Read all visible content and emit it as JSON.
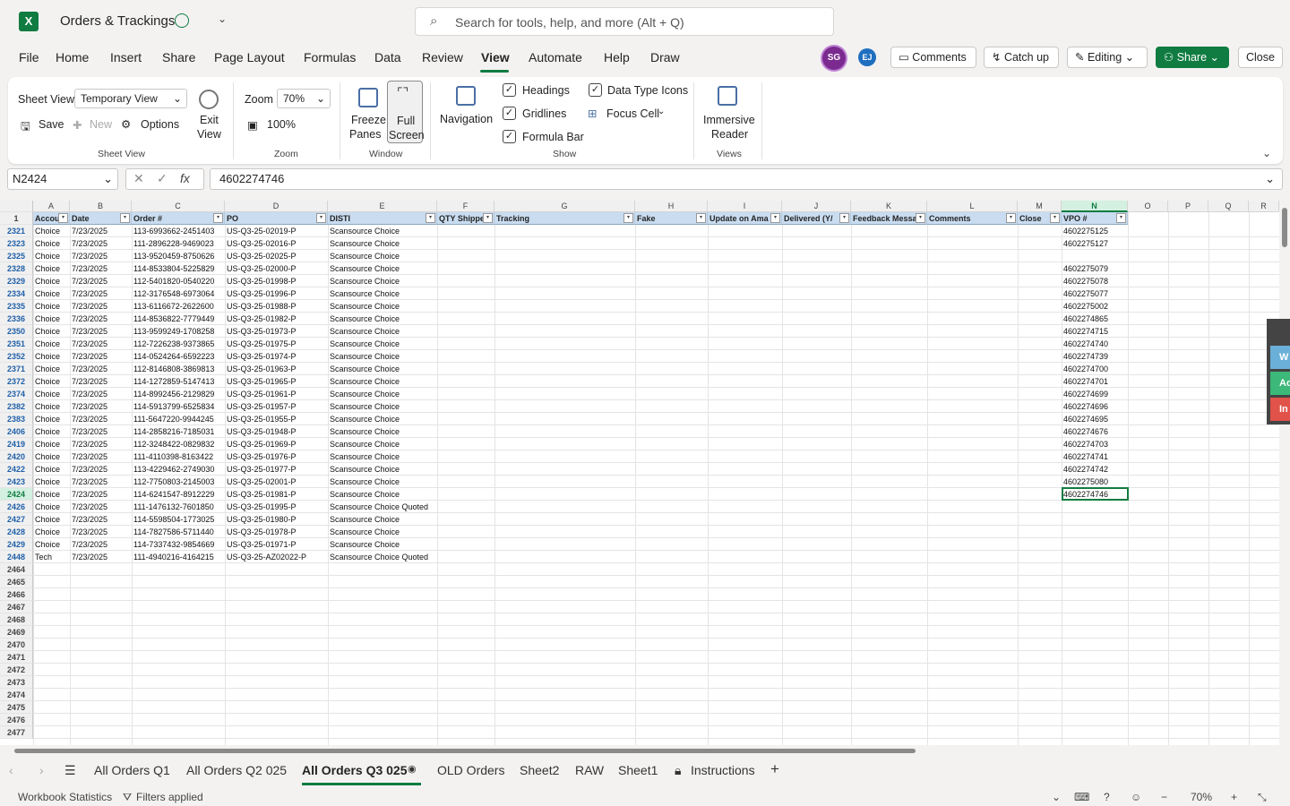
{
  "titlebar": {
    "app_icon": "excel-icon",
    "doc_title": "Orders & Trackings",
    "search_placeholder": "Search for tools, help, and more (Alt + Q)"
  },
  "menu": [
    "File",
    "Home",
    "Insert",
    "Share",
    "Page Layout",
    "Formulas",
    "Data",
    "Review",
    "View",
    "Automate",
    "Help",
    "Draw"
  ],
  "active_menu": "View",
  "header_right": {
    "avatar1": "SG",
    "avatar2": "EJ",
    "comments": "Comments",
    "catchup": "Catch up",
    "editing": "Editing",
    "share": "Share",
    "close": "Close"
  },
  "ribbon": {
    "sheet_view_label": "Sheet View",
    "sheet_view_value": "Temporary View",
    "save": "Save",
    "new": "New",
    "options": "Options",
    "exit_view": "Exit View",
    "exit": "Exit",
    "view": "View",
    "group_sheet_view": "Sheet View",
    "zoom_label": "Zoom",
    "zoom_value": "70%",
    "zoom_100": "100%",
    "group_zoom": "Zoom",
    "freeze": "Freeze",
    "panes": "Panes",
    "full": "Full",
    "screen": "Screen",
    "group_window": "Window",
    "navigation": "Navigation",
    "headings": "Headings",
    "gridlines": "Gridlines",
    "formula_bar": "Formula Bar",
    "data_type_icons": "Data Type Icons",
    "focus_cell": "Focus Cell",
    "group_show": "Show",
    "immersive": "Immersive",
    "reader": "Reader",
    "group_views": "Views"
  },
  "formula_bar": {
    "name_box": "N2424",
    "value": "4602274746"
  },
  "columns": [
    "A",
    "B",
    "C",
    "D",
    "E",
    "F",
    "G",
    "H",
    "I",
    "J",
    "K",
    "L",
    "M",
    "N",
    "O",
    "P",
    "Q",
    "R"
  ],
  "table_headers": [
    "Accou",
    "Date",
    "Order #",
    "PO",
    "DISTI",
    "QTY Shippe",
    "Tracking",
    "Fake",
    "Update on Ama",
    "Delivered (Y/",
    "Feedback Messa",
    "Comments",
    "Close",
    "VPO #"
  ],
  "rows": [
    {
      "row": "2321",
      "acct": "Choice",
      "date": "7/23/2025",
      "order": "113-6993662-2451403",
      "po": "US-Q3-25-02019-P",
      "disti": "Scansource Choice",
      "vpo": "4602275125"
    },
    {
      "row": "2323",
      "acct": "Choice",
      "date": "7/23/2025",
      "order": "111-2896228-9469023",
      "po": "US-Q3-25-02016-P",
      "disti": "Scansource Choice",
      "vpo": "4602275127"
    },
    {
      "row": "2325",
      "acct": "Choice",
      "date": "7/23/2025",
      "order": "113-9520459-8750626",
      "po": "US-Q3-25-02025-P",
      "disti": "Scansource Choice",
      "vpo": ""
    },
    {
      "row": "2328",
      "acct": "Choice",
      "date": "7/23/2025",
      "order": "114-8533804-5225829",
      "po": "US-Q3-25-02000-P",
      "disti": "Scansource Choice",
      "vpo": "4602275079"
    },
    {
      "row": "2329",
      "acct": "Choice",
      "date": "7/23/2025",
      "order": "112-5401820-0540220",
      "po": "US-Q3-25-01998-P",
      "disti": "Scansource Choice",
      "vpo": "4602275078"
    },
    {
      "row": "2334",
      "acct": "Choice",
      "date": "7/23/2025",
      "order": "112-3176548-6973064",
      "po": "US-Q3-25-01996-P",
      "disti": "Scansource Choice",
      "vpo": "4602275077"
    },
    {
      "row": "2335",
      "acct": "Choice",
      "date": "7/23/2025",
      "order": "113-6116672-2622600",
      "po": "US-Q3-25-01988-P",
      "disti": "Scansource Choice",
      "vpo": "4602275002"
    },
    {
      "row": "2336",
      "acct": "Choice",
      "date": "7/23/2025",
      "order": "114-8536822-7779449",
      "po": "US-Q3-25-01982-P",
      "disti": "Scansource Choice",
      "vpo": "4602274865"
    },
    {
      "row": "2350",
      "acct": "Choice",
      "date": "7/23/2025",
      "order": "113-9599249-1708258",
      "po": "US-Q3-25-01973-P",
      "disti": "Scansource Choice",
      "vpo": "4602274715"
    },
    {
      "row": "2351",
      "acct": "Choice",
      "date": "7/23/2025",
      "order": "112-7226238-9373865",
      "po": "US-Q3-25-01975-P",
      "disti": "Scansource Choice",
      "vpo": "4602274740"
    },
    {
      "row": "2352",
      "acct": "Choice",
      "date": "7/23/2025",
      "order": "114-0524264-6592223",
      "po": "US-Q3-25-01974-P",
      "disti": "Scansource Choice",
      "vpo": "4602274739"
    },
    {
      "row": "2371",
      "acct": "Choice",
      "date": "7/23/2025",
      "order": "112-8146808-3869813",
      "po": "US-Q3-25-01963-P",
      "disti": "Scansource Choice",
      "vpo": "4602274700"
    },
    {
      "row": "2372",
      "acct": "Choice",
      "date": "7/23/2025",
      "order": "114-1272859-5147413",
      "po": "US-Q3-25-01965-P",
      "disti": "Scansource Choice",
      "vpo": "4602274701"
    },
    {
      "row": "2374",
      "acct": "Choice",
      "date": "7/23/2025",
      "order": "114-8992456-2129829",
      "po": "US-Q3-25-01961-P",
      "disti": "Scansource Choice",
      "vpo": "4602274699"
    },
    {
      "row": "2382",
      "acct": "Choice",
      "date": "7/23/2025",
      "order": "114-5913799-6525834",
      "po": "US-Q3-25-01957-P",
      "disti": "Scansource Choice",
      "vpo": "4602274696"
    },
    {
      "row": "2383",
      "acct": "Choice",
      "date": "7/23/2025",
      "order": "111-5647220-9944245",
      "po": "US-Q3-25-01955-P",
      "disti": "Scansource Choice",
      "vpo": "4602274695"
    },
    {
      "row": "2406",
      "acct": "Choice",
      "date": "7/23/2025",
      "order": "114-2858216-7185031",
      "po": "US-Q3-25-01948-P",
      "disti": "Scansource Choice",
      "vpo": "4602274676"
    },
    {
      "row": "2419",
      "acct": "Choice",
      "date": "7/23/2025",
      "order": "112-3248422-0829832",
      "po": "US-Q3-25-01969-P",
      "disti": "Scansource Choice",
      "vpo": "4602274703"
    },
    {
      "row": "2420",
      "acct": "Choice",
      "date": "7/23/2025",
      "order": "111-4110398-8163422",
      "po": "US-Q3-25-01976-P",
      "disti": "Scansource Choice",
      "vpo": "4602274741"
    },
    {
      "row": "2422",
      "acct": "Choice",
      "date": "7/23/2025",
      "order": "113-4229462-2749030",
      "po": "US-Q3-25-01977-P",
      "disti": "Scansource Choice",
      "vpo": "4602274742"
    },
    {
      "row": "2423",
      "acct": "Choice",
      "date": "7/23/2025",
      "order": "112-7750803-2145003",
      "po": "US-Q3-25-02001-P",
      "disti": "Scansource Choice",
      "vpo": "4602275080"
    },
    {
      "row": "2424",
      "acct": "Choice",
      "date": "7/23/2025",
      "order": "114-6241547-8912229",
      "po": "US-Q3-25-01981-P",
      "disti": "Scansource Choice",
      "vpo": "4602274746"
    },
    {
      "row": "2426",
      "acct": "Choice",
      "date": "7/23/2025",
      "order": "111-1476132-7601850",
      "po": "US-Q3-25-01995-P",
      "disti": "Scansource Choice Quoted",
      "vpo": ""
    },
    {
      "row": "2427",
      "acct": "Choice",
      "date": "7/23/2025",
      "order": "114-5598504-1773025",
      "po": "US-Q3-25-01980-P",
      "disti": "Scansource Choice",
      "vpo": ""
    },
    {
      "row": "2428",
      "acct": "Choice",
      "date": "7/23/2025",
      "order": "114-7827586-5711440",
      "po": "US-Q3-25-01978-P",
      "disti": "Scansource Choice",
      "vpo": ""
    },
    {
      "row": "2429",
      "acct": "Choice",
      "date": "7/23/2025",
      "order": "114-7337432-9854669",
      "po": "US-Q3-25-01971-P",
      "disti": "Scansource Choice",
      "vpo": ""
    },
    {
      "row": "2448",
      "acct": "Tech",
      "date": "7/23/2025",
      "order": "111-4940216-4164215",
      "po": "US-Q3-25-AZ02022-P",
      "disti": "Scansource Choice Quoted",
      "vpo": ""
    }
  ],
  "empty_rows": [
    "2464",
    "2465",
    "2466",
    "2467",
    "2468",
    "2469",
    "2470",
    "2471",
    "2472",
    "2473",
    "2474",
    "2475",
    "2476",
    "2477"
  ],
  "side_tabs": [
    "W",
    "Ac",
    "In"
  ],
  "sheet_tabs": [
    "All Orders Q1",
    "All Orders Q2 025",
    "All Orders Q3 025",
    "OLD Orders",
    "Sheet2",
    "RAW",
    "Sheet1",
    "Instructions"
  ],
  "active_sheet": "All Orders Q3 025",
  "status": {
    "workbook_stats": "Workbook Statistics",
    "filters": "Filters applied",
    "zoom": "70%"
  },
  "colors": {
    "accent": "#107c41",
    "header_fill": "#c9dcf0",
    "avatar_sg": "#7b2a8f",
    "avatar_ej": "#1f6fc0"
  }
}
